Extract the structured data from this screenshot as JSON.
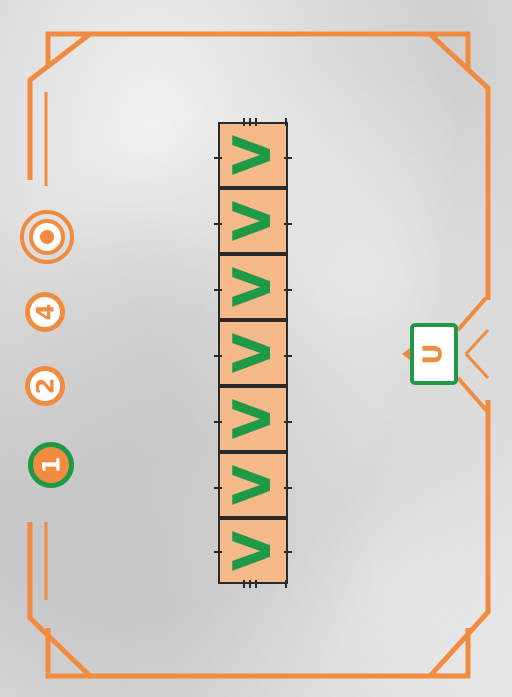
{
  "colors": {
    "frame": "#f08b40",
    "accent_green": "#1e9a47",
    "cell_fill": "#f6b98a",
    "cell_border": "#2a2a2a"
  },
  "strip": {
    "cells": [
      {
        "mark": "V"
      },
      {
        "mark": "V"
      },
      {
        "mark": "V"
      },
      {
        "mark": "V"
      },
      {
        "mark": "V"
      },
      {
        "mark": "V"
      },
      {
        "mark": "V"
      }
    ]
  },
  "badges": {
    "first": "4",
    "second": "2",
    "third": "1"
  },
  "side_card": {
    "symbol": "U"
  },
  "icons": {
    "target": "target-icon"
  }
}
